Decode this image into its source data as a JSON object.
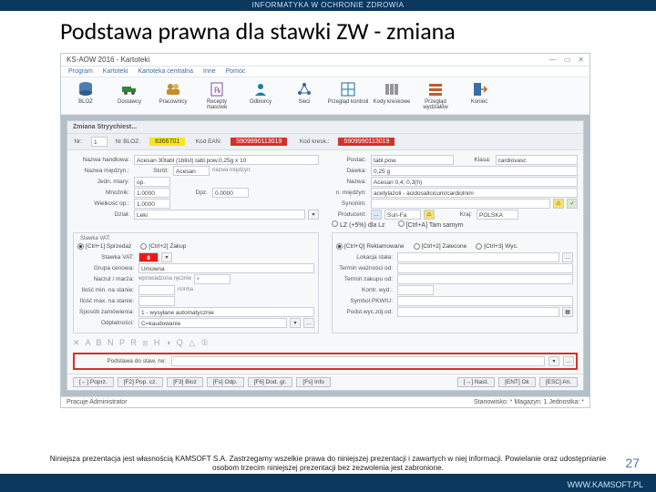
{
  "banner": "INFORMATYKA W OCHRONIE ZDROWIA",
  "slide_title": "Podstawa prawna dla stawki ZW - zmiana",
  "window": {
    "title": "KS-AOW 2016 - Kartoteki",
    "menu": [
      "Program",
      "Kartoteki",
      "Kartoteka centralna",
      "Inne",
      "Pomoc"
    ],
    "ribbon": [
      {
        "label": "BLOZ",
        "icon": "db-icon",
        "color": "#4b7db4"
      },
      {
        "label": "Dostawcy",
        "icon": "truck-icon",
        "color": "#2a8a3a"
      },
      {
        "label": "Pracownicy",
        "icon": "people-icon",
        "color": "#c28d2a"
      },
      {
        "label": "Recepty masowe",
        "icon": "rx-icon",
        "color": "#7c4da6"
      },
      {
        "label": "Odbiorcy",
        "icon": "person-icon",
        "color": "#1b7fa5"
      },
      {
        "label": "Sieci",
        "icon": "net-icon",
        "color": "#3a64a0"
      },
      {
        "label": "Przegląd kontroli",
        "icon": "grid-icon",
        "color": "#1f6e9b"
      },
      {
        "label": "Kody kreskowe",
        "icon": "barcode-icon",
        "color": "#333"
      },
      {
        "label": "Przegląd wydziałów",
        "icon": "list-icon",
        "color": "#bf5c2e"
      },
      {
        "label": "Koniec",
        "icon": "exit-icon",
        "color": "#3a6ea5"
      }
    ]
  },
  "panel_title": "Zmiana Stryychiest...",
  "idrow": {
    "nr_label": "Nr:",
    "nr": "1",
    "nrbloz_label": "Nr BLOZ:",
    "nrbloz": "8366701",
    "kodean_label": "Kod EAN:",
    "kodean": "5909990113019",
    "kodkresk_label": "Kod kresk.:",
    "kodkresk": "5909990113019"
  },
  "form": {
    "nazwa_handlowa": {
      "label": "Nazwa handlowa:",
      "value": "Acesan 30tabl (1blist) tabl.pow.0,25g x 10"
    },
    "skrot_label": "Skrót:",
    "skrot": "Acesan",
    "skrot_hint": "nazwa międzyn.",
    "nazwa_miedzyn": {
      "label": "Nazwa międzyn.:",
      "value": ""
    },
    "jedn_miary": {
      "label": "Jedn. miary:",
      "value": "op."
    },
    "mnoznik": {
      "label": "Mnożnik:",
      "value": "1.0000"
    },
    "wielkosc_op": {
      "label": "Wielkość op.:",
      "value": "1.0000"
    },
    "dzial": {
      "label": "Dział:",
      "value": "Leki"
    },
    "dpz": {
      "label": "Dpz.",
      "value": "0.0000"
    },
    "postac": {
      "label": "Postać:",
      "value": "tabl.pow."
    },
    "klasa": {
      "label": "Klasa:",
      "value": "cardiovasc"
    },
    "dawka": {
      "label": "Dawka:",
      "value": "0,25 g"
    },
    "nazwa_wtorna": {
      "label": "Nazwa:",
      "value": "Acesan 0,4; 0,3(h)"
    },
    "n_miedzyn": {
      "label": "n. międzyn:",
      "value": "acetylazoli - acidosalicicum/cardiolnim"
    },
    "synonim": {
      "label": "Synonim:",
      "value": ""
    },
    "producent": {
      "label": "Producent:",
      "hint": "Sun-Fa",
      "kraj_label": "Kraj:",
      "kraj": "POLSKA"
    },
    "checks": {
      "a": "LZ (+5%) dla Lz",
      "b": "[Ctrl+A] Tam samym"
    },
    "fieldset1": {
      "title": "Stawka VAT:",
      "r1": "[Ctrl+1] Sprzedaż",
      "r2": "[Ctrl+2] Zakup"
    },
    "fieldset2": {
      "r1": "[Ctrl+Q] Reklamowane",
      "r2": "[Ctrl+2] Zalecone",
      "r3": "[Ctrl+3] Wyc."
    },
    "vat_row": {
      "label": "Stawka VAT:",
      "value": "8"
    },
    "grupa": {
      "label": "Grupa cenowa:",
      "value": "Umowna"
    },
    "narzut": {
      "label": "Narzut / marża:",
      "hint": "wprowadzona ręcznie",
      "val": "*"
    },
    "sposob": {
      "label": "Sposób zamówienia:",
      "value": "1 - wysyłane automatycznie"
    },
    "termin": {
      "label": "Termin ważności od:",
      "value": ""
    },
    "lok": {
      "label": "Lokacja stała:",
      "value": ""
    },
    "iloscmin": {
      "label": "Ilość min. na stanie:",
      "hint": "norma",
      "value": ""
    },
    "iloscmax": {
      "label": "Ilość max. na stanie:",
      "value": ""
    },
    "termvat": {
      "label": "Termin zakupu od:",
      "value": ""
    },
    "kontr": {
      "label": "Kontr. wyd.:",
      "value": ""
    },
    "symbol": {
      "label": "Symbol PKWIU:",
      "value": ""
    },
    "odplatnosci": {
      "label": "Odpłatności:",
      "value": "C=kaudowanie"
    },
    "podstzdj": {
      "label": "Podst.wyc.zdj.od:",
      "value": ""
    },
    "podstawa": {
      "label": "Podstawa do staw. rw:",
      "value": ""
    }
  },
  "icons_strip": "✕ A B N P R ⦻ H ◑ Q △ ①",
  "bottom_buttons": [
    "[←] Poprz.",
    "[F2] Pop. cz.",
    "[F3] Bloz",
    "[Fs] Odp.",
    "[F6] Dod. gr.",
    "[Fs] Info",
    "[→] Nast.",
    "[ENT] Ok",
    "[ESC] An."
  ],
  "status": {
    "left": "Pracuje Administrator",
    "right": "Stanowisko: *   Magazyn: 1   Jednostka: *"
  },
  "disclaimer": "Niniejsza prezentacja jest własnością KAMSOFT S.A. Zastrzegamy wszelkie prawa do niniejszej prezentacji i zawartych w niej informacji. Powielanie oraz udostępnianie osobom trzecim niniejszej prezentacji bez zezwolenia jest zabronione.",
  "page_num": "27",
  "footer_url": "WWW.KAMSOFT.PL"
}
